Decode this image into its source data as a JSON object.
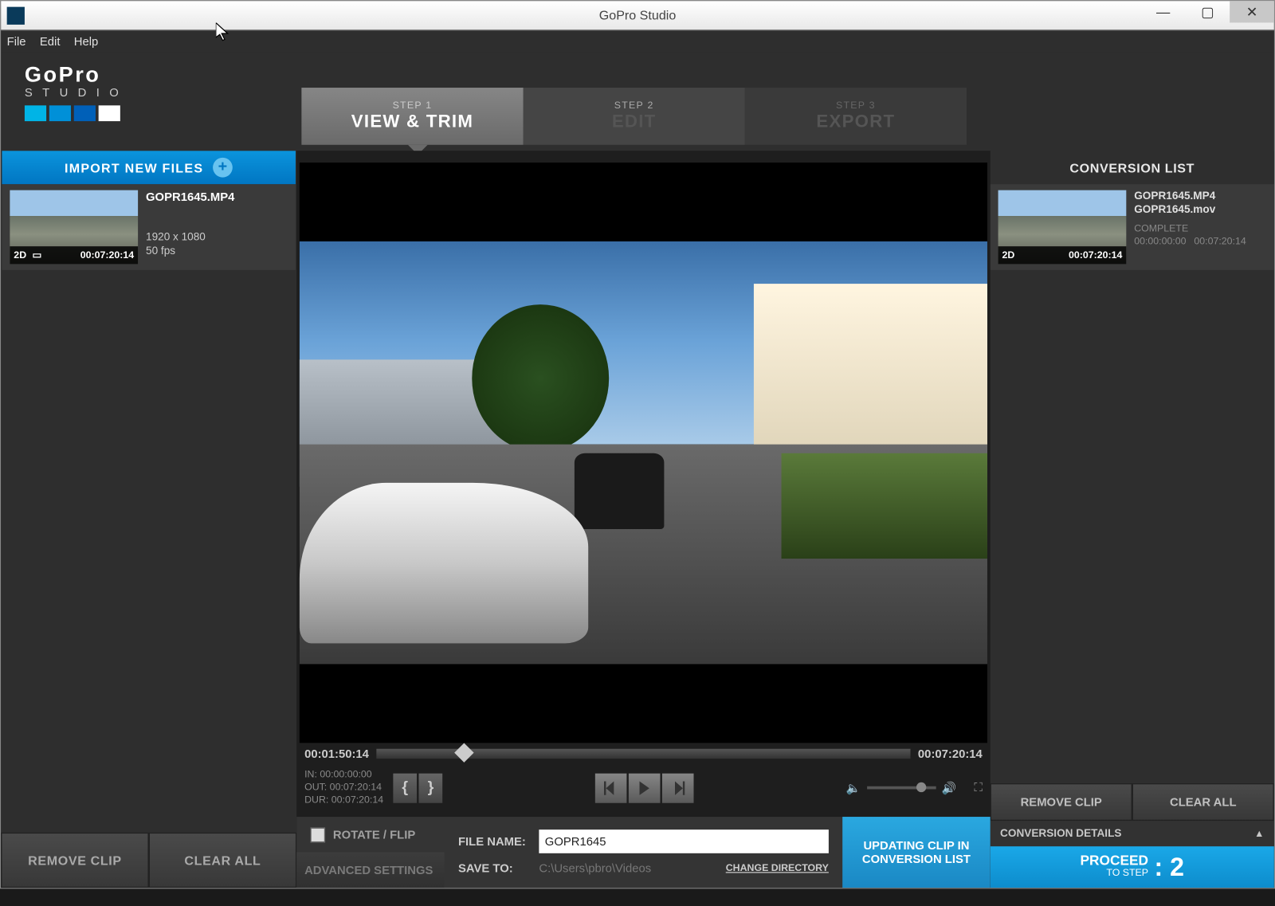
{
  "titlebar": {
    "title": "GoPro Studio"
  },
  "menu": {
    "file": "File",
    "edit": "Edit",
    "help": "Help"
  },
  "logo": {
    "brand": "GoPro",
    "sub": "STUDIO"
  },
  "steps": {
    "s1_label": "STEP 1",
    "s1_title": "VIEW & TRIM",
    "s2_label": "STEP 2",
    "s2_title": "EDIT",
    "s3_label": "STEP 3",
    "s3_title": "EXPORT"
  },
  "left": {
    "import": "IMPORT NEW FILES",
    "clip": {
      "name": "GOPR1645.MP4",
      "res": "1920 x 1080",
      "fps": "50 fps",
      "mode": "2D",
      "tc": "00:07:20:14"
    },
    "remove": "REMOVE CLIP",
    "clear": "CLEAR ALL"
  },
  "player": {
    "current_tc": "00:01:50:14",
    "end_tc": "00:07:20:14",
    "in_label": "IN:",
    "in": "00:00:00:00",
    "out_label": "OUT:",
    "out": "00:07:20:14",
    "dur_label": "DUR:",
    "dur": "00:07:20:14"
  },
  "bottom": {
    "rotate": "ROTATE / FLIP",
    "advanced": "ADVANCED SETTINGS",
    "filename_label": "FILE NAME:",
    "filename": "GOPR1645",
    "saveto_label": "SAVE TO:",
    "saveto": "C:\\Users\\pbro\\Videos",
    "changedir": "CHANGE DIRECTORY",
    "updating": "UPDATING CLIP IN CONVERSION LIST"
  },
  "right": {
    "header": "CONVERSION LIST",
    "clip": {
      "name1": "GOPR1645.MP4",
      "name2": "GOPR1645.mov",
      "status": "COMPLETE",
      "t1": "00:00:00:00",
      "t2": "00:07:20:14",
      "mode": "2D",
      "tc": "00:07:20:14"
    },
    "remove": "REMOVE CLIP",
    "clear": "CLEAR ALL",
    "details": "CONVERSION DETAILS",
    "proceed_line1": "PROCEED",
    "proceed_line2": "TO STEP",
    "proceed_num": ": 2"
  }
}
